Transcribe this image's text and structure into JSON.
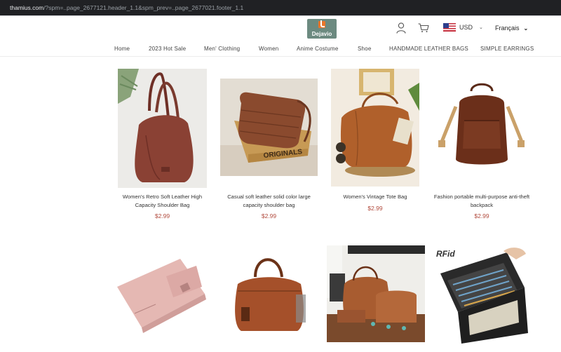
{
  "browser": {
    "url_host": "thamius.com",
    "url_path": "/?spm=..page_2677121.header_1.1&spm_prev=..page_2677021.footer_1.1"
  },
  "header": {
    "logo_text": "Dejavio",
    "currency": "USD",
    "language": "Français",
    "icons": [
      "user-icon",
      "cart-icon",
      "us-flag-icon"
    ]
  },
  "nav": {
    "items": [
      {
        "label": "Home"
      },
      {
        "label": "2023 Hot Sale"
      },
      {
        "label": "Men' Clothing"
      },
      {
        "label": "Women"
      },
      {
        "label": "Anime Costume"
      },
      {
        "label": "Shoe"
      },
      {
        "label": "HANDMADE LEATHER BAGS"
      },
      {
        "label": "SIMPLE EARRINGS"
      }
    ]
  },
  "products": [
    {
      "title": "Women's Retro Soft Leather High Capacity Shoulder Bag",
      "price": "$2.99"
    },
    {
      "title": "Casual soft leather solid color large capacity shoulder bag",
      "price": "$2.99"
    },
    {
      "title": "Women's Vintage Tote Bag",
      "price": "$2.99"
    },
    {
      "title": "Fashion portable multi-purpose anti-theft backpack",
      "price": "$2.99"
    },
    {
      "title": "",
      "price": ""
    },
    {
      "title": "",
      "price": ""
    },
    {
      "title": "",
      "price": ""
    },
    {
      "title": "",
      "price": ""
    }
  ],
  "image_texts": {
    "box_label": "ORIGINALS",
    "wallet_label": "RFid"
  },
  "colors": {
    "price": "#b14a3c",
    "logo_bg": "#6c8a80",
    "logo_accent": "#e8762b",
    "url_bar": "#202124"
  }
}
